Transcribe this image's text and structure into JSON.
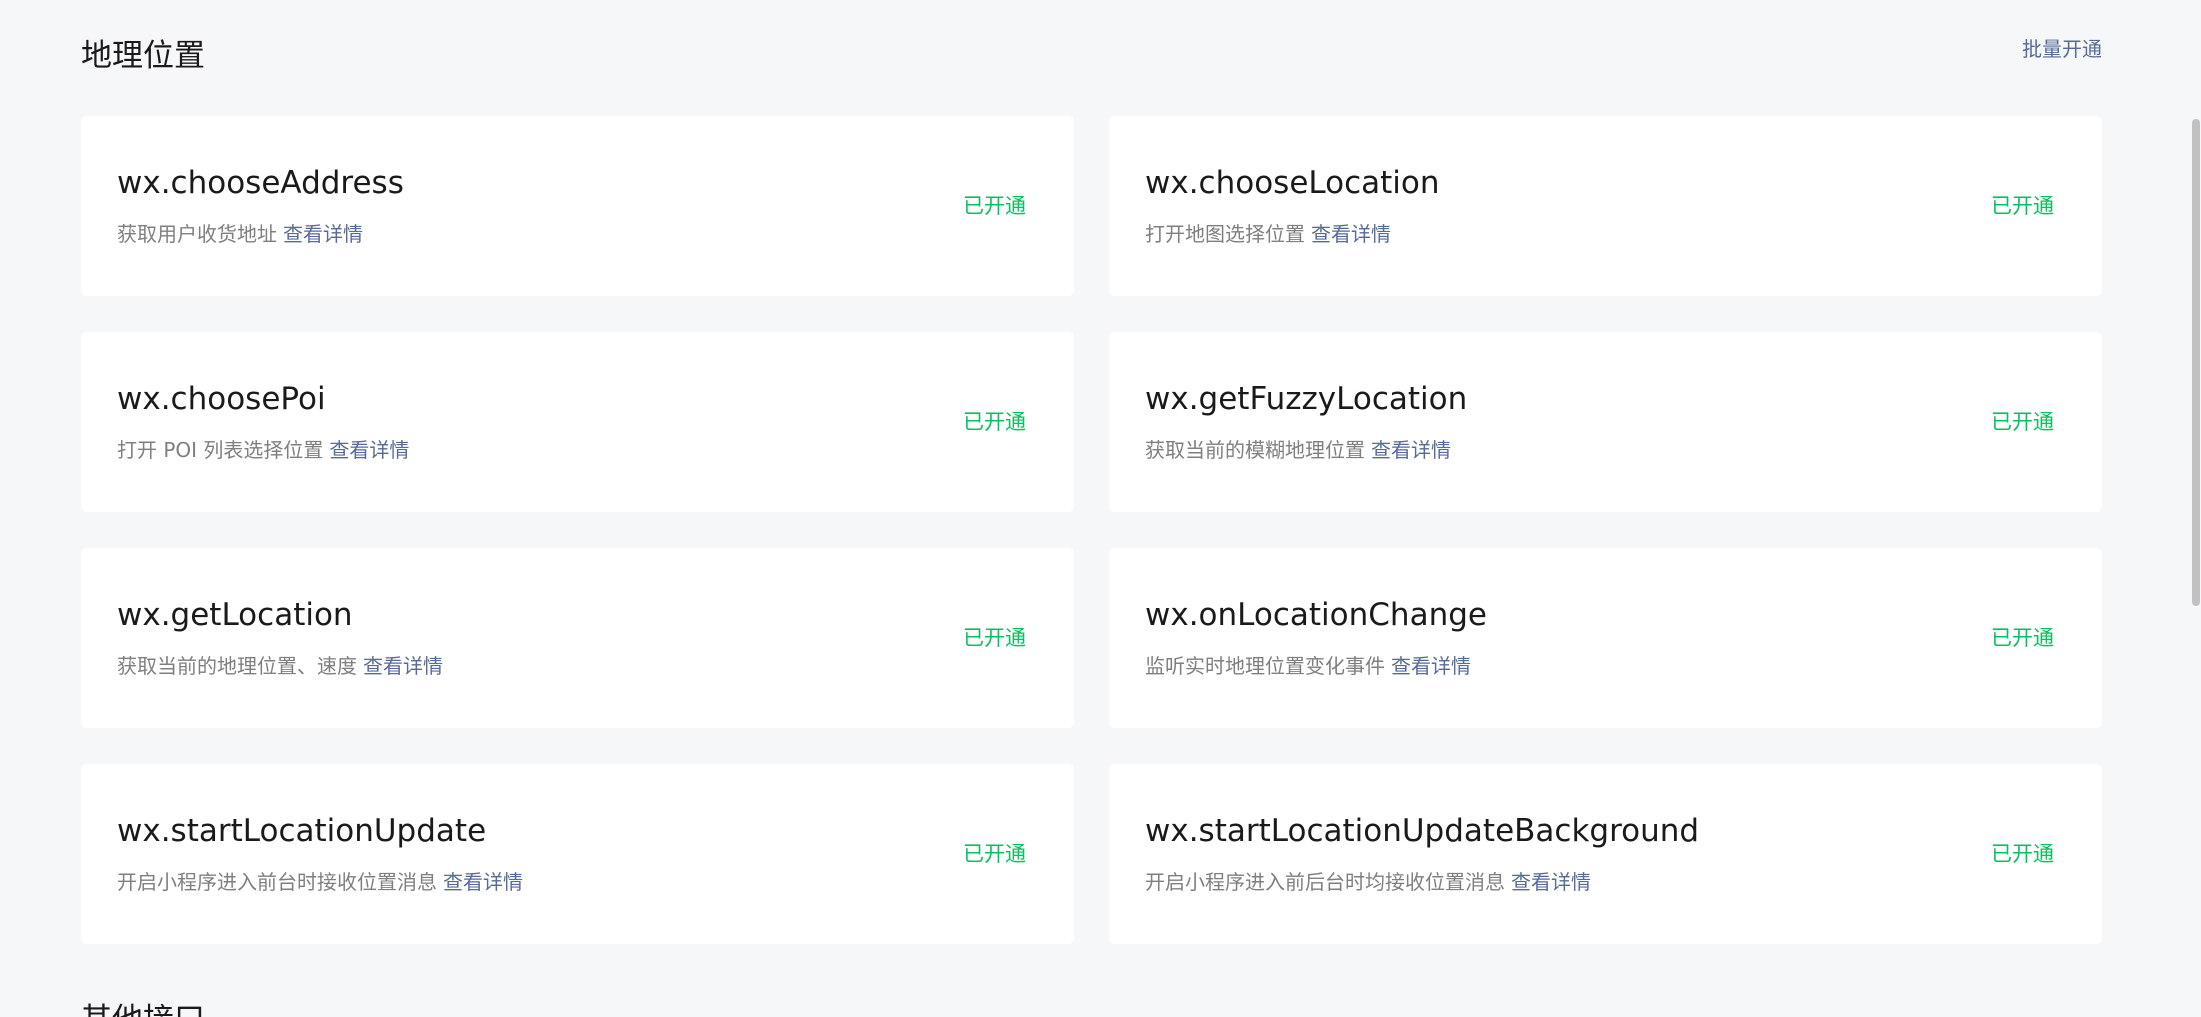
{
  "section": {
    "title": "地理位置",
    "batch_action": "批量开通"
  },
  "apis": [
    {
      "name": "wx.chooseAddress",
      "desc": "获取用户收货地址",
      "detail": "查看详情",
      "status": "已开通"
    },
    {
      "name": "wx.chooseLocation",
      "desc": "打开地图选择位置",
      "detail": "查看详情",
      "status": "已开通"
    },
    {
      "name": "wx.choosePoi",
      "desc": "打开 POI 列表选择位置",
      "detail": "查看详情",
      "status": "已开通"
    },
    {
      "name": "wx.getFuzzyLocation",
      "desc": "获取当前的模糊地理位置",
      "detail": "查看详情",
      "status": "已开通"
    },
    {
      "name": "wx.getLocation",
      "desc": "获取当前的地理位置、速度",
      "detail": "查看详情",
      "status": "已开通"
    },
    {
      "name": "wx.onLocationChange",
      "desc": "监听实时地理位置变化事件",
      "detail": "查看详情",
      "status": "已开通"
    },
    {
      "name": "wx.startLocationUpdate",
      "desc": "开启小程序进入前台时接收位置消息",
      "detail": "查看详情",
      "status": "已开通"
    },
    {
      "name": "wx.startLocationUpdateBackground",
      "desc": "开启小程序进入前后台时均接收位置消息",
      "detail": "查看详情",
      "status": "已开通"
    }
  ],
  "next_section": {
    "title": "其他接口"
  },
  "colors": {
    "background": "#f6f7f9",
    "card": "#ffffff",
    "status_green": "#07c160",
    "link_blue": "#576b95",
    "desc_gray": "#7f7f7f"
  }
}
